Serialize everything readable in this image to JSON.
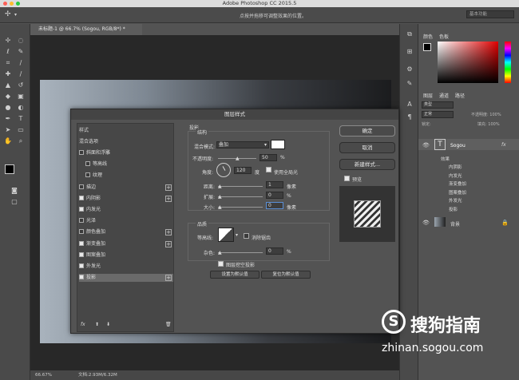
{
  "app": {
    "title": "Adobe Photoshop CC 2015.5",
    "hint": "点按并拖移可调整效果的位置。",
    "workspace": "基本功能"
  },
  "doc": {
    "tab": "未标题-1 @ 66.7% (Sogou, RGB/8*) *",
    "zoom": "66.67%",
    "docsize": "文档:2.93M/6.32M"
  },
  "panels": {
    "color_tab": "颜色",
    "swatch_tab": "色板",
    "layers_tab": "图层",
    "channels_tab": "通道",
    "paths_tab": "路径",
    "kind": "类型",
    "mode": "正常",
    "opacity": "不透明度: 100%",
    "lock": "锁定:",
    "fill": "填充: 100%",
    "layer_text": "Sogou",
    "effects": "效果",
    "effect_items": [
      "内阴影",
      "内发光",
      "渐变叠加",
      "图案叠加",
      "外发光",
      "投影"
    ],
    "bg_layer": "背景",
    "fx": "fx"
  },
  "dialog": {
    "title": "图层样式",
    "styles_header": "样式",
    "blend_options": "混合选项",
    "items": [
      "斜面和浮雕",
      "等高线",
      "纹理",
      "描边",
      "内阴影",
      "内发光",
      "光泽",
      "颜色叠加",
      "渐变叠加",
      "图案叠加",
      "外发光",
      "投影"
    ],
    "section": "投影",
    "struct": "结构",
    "blend_mode_label": "混合模式:",
    "blend_mode": "叠加",
    "opacity_label": "不透明度:",
    "opacity": "50",
    "pct": "%",
    "angle_label": "角度:",
    "angle": "120",
    "deg": "度",
    "global_light": "使用全局光",
    "distance_label": "距离:",
    "distance": "1",
    "px": "像素",
    "spread_label": "扩展:",
    "spread": "0",
    "size_label": "大小:",
    "size": "0",
    "quality": "品质",
    "contour_label": "等高线:",
    "antialias": "消除锯齿",
    "noise_label": "杂色:",
    "noise": "0",
    "knockout": "图层挖空投影",
    "make_default": "设置为默认值",
    "reset_default": "复位为默认值",
    "ok": "确定",
    "cancel": "取消",
    "new_style": "新建样式...",
    "preview": "预览",
    "fx": "fx"
  },
  "watermark": {
    "brand": "搜狗指南",
    "url": "zhinan.sogou.com"
  }
}
